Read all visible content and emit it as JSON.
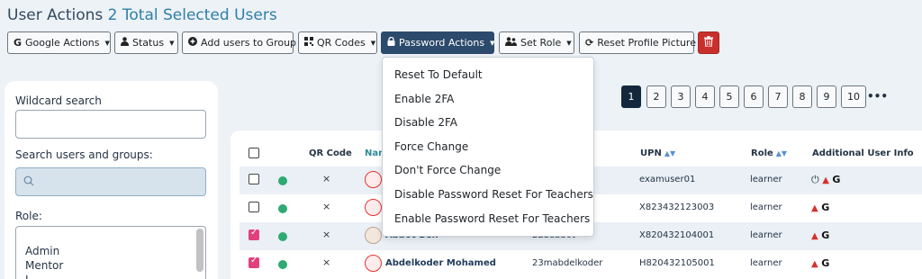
{
  "header": {
    "title": "User Actions",
    "subtitle": "2 Total Selected Users"
  },
  "toolbar": {
    "google_actions": "Google Actions",
    "status": "Status",
    "add_users_to_group": "Add users to Group",
    "qr_codes": "QR Codes",
    "password_actions": "Password Actions",
    "set_role": "Set Role",
    "reset_profile_picture": "Reset Profile Picture"
  },
  "filters": {
    "wildcard_label": "Wildcard search",
    "wildcard_value": "",
    "search_label": "Search users and groups:",
    "search_value": "",
    "role_label": "Role:",
    "role_options": [
      "Admin",
      "Mentor",
      "L"
    ]
  },
  "pagination": {
    "pages": [
      "1",
      "2",
      "3",
      "4",
      "5",
      "6",
      "7",
      "8",
      "9",
      "10"
    ],
    "active": "1",
    "more": "•••"
  },
  "table": {
    "headers": {
      "qr_code": "QR Code",
      "name": "Nam",
      "upn": "UPN",
      "role": "Role",
      "additional": "Additional User Info"
    },
    "rows": [
      {
        "name": "",
        "username": "",
        "upn": "examuser01",
        "role": "learner",
        "checked": false
      },
      {
        "name": "",
        "username": "",
        "upn": "X823432123003",
        "role": "learner",
        "checked": false
      },
      {
        "name": "Abbot Ben",
        "username": "22babbot",
        "upn": "X820432104001",
        "role": "learner",
        "checked": true
      },
      {
        "name": "Abdelkoder Mohamed",
        "username": "23mabdelkoder",
        "upn": "H820432105001",
        "role": "learner",
        "checked": true
      }
    ],
    "qr_mark": "×",
    "info_g": "G"
  },
  "password_menu": {
    "items": [
      "Reset To Default",
      "Enable 2FA",
      "Disable 2FA",
      "Force Change",
      "Don't Force Change",
      "Disable Password Reset For Teachers",
      "Enable Password Reset For Teachers"
    ]
  },
  "colors": {
    "primary_dark": "#2c4a6b",
    "danger": "#c9302c",
    "success_dot": "#2eaa72",
    "checkbox_pink": "#e2407d"
  }
}
